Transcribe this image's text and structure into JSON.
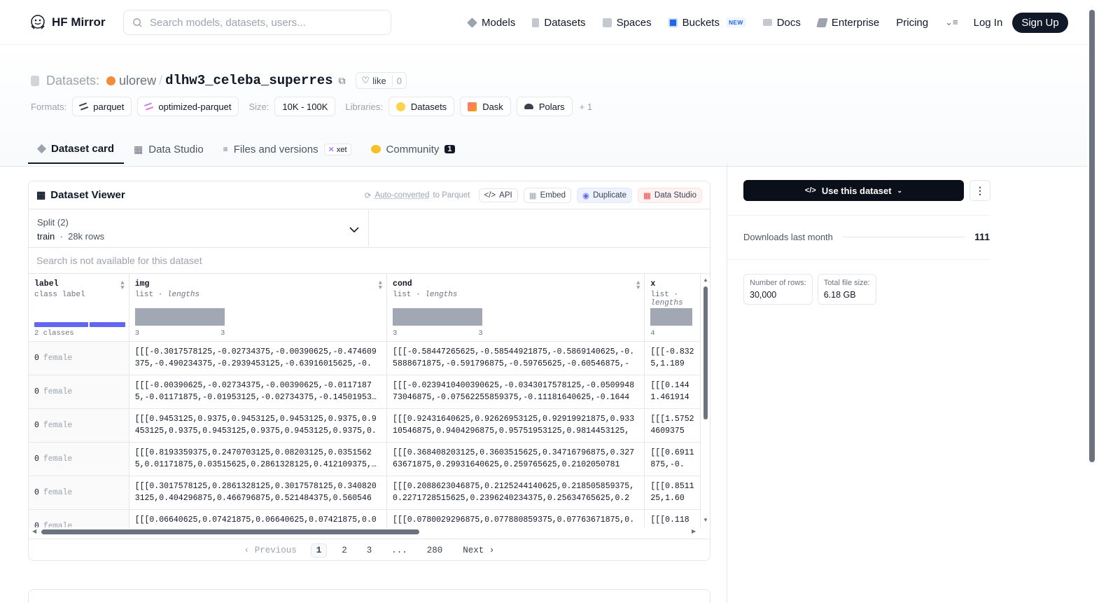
{
  "nav": {
    "brand": "HF Mirror",
    "search_placeholder": "Search models, datasets, users...",
    "links": [
      {
        "label": "Models",
        "icon": "cube-icon",
        "color": "#9ca3af"
      },
      {
        "label": "Datasets",
        "icon": "database-icon",
        "color": "#9ca3af"
      },
      {
        "label": "Spaces",
        "icon": "grid-icon",
        "color": "#9ca3af"
      },
      {
        "label": "Buckets",
        "icon": "bucket-icon",
        "color": "#2563eb",
        "badge": "NEW"
      },
      {
        "label": "Docs",
        "icon": "book-icon",
        "color": "#9ca3af"
      },
      {
        "label": "Enterprise",
        "icon": "building-icon",
        "color": "#9ca3af"
      },
      {
        "label": "Pricing"
      }
    ],
    "login": "Log In",
    "signup": "Sign Up"
  },
  "repo": {
    "prefix": "Datasets:",
    "owner": "ulorew",
    "name": "dlhw3_celeba_superres",
    "like_label": "like",
    "like_count": "0"
  },
  "tags": {
    "formats_label": "Formats:",
    "formats": [
      "parquet",
      "optimized-parquet"
    ],
    "size_label": "Size:",
    "size": "10K - 100K",
    "libraries_label": "Libraries:",
    "libraries": [
      "Datasets",
      "Dask",
      "Polars"
    ],
    "more": "+ 1"
  },
  "tabs": [
    {
      "label": "Dataset card",
      "active": true
    },
    {
      "label": "Data Studio"
    },
    {
      "label": "Files and versions",
      "badge": "xet"
    },
    {
      "label": "Community",
      "count": "1"
    }
  ],
  "viewer": {
    "title": "Dataset Viewer",
    "auto_converted": "Auto-converted",
    "auto_converted_suffix": "to Parquet",
    "actions": [
      "API",
      "Embed",
      "Duplicate",
      "Data Studio"
    ],
    "split_label": "Split (2)",
    "split_value": "train",
    "split_rows": "28k rows",
    "search_na": "Search is not available for this dataset",
    "columns": [
      {
        "name": "label",
        "type": "class label",
        "type_extra": "",
        "summary": "2 classes",
        "class_fractions": [
          0.6,
          0.4
        ]
      },
      {
        "name": "img",
        "type": "list",
        "type_extra": "lengths",
        "min": "3",
        "max": "3"
      },
      {
        "name": "cond",
        "type": "list",
        "type_extra": "lengths",
        "min": "3",
        "max": "3"
      },
      {
        "name": "x",
        "type": "list",
        "type_extra": "lengths",
        "min": "4",
        "max": ""
      }
    ],
    "rows": [
      {
        "label_num": "0",
        "label_txt": "female",
        "img": "[[[-0.3017578125,-0.02734375,-0.00390625,-0.474609375,-0.490234375,-0.2939453125,-0.63916015625,-0.",
        "cond": "[[[-0.58447265625,-0.58544921875,-0.5869140625,-0.5888671875,-0.591796875,-0.59765625,-0.60546875,-",
        "x": "[[[-0.8325,1.189"
      },
      {
        "label_num": "0",
        "label_txt": "female",
        "img": "[[[-0.00390625,-0.02734375,-0.00390625,-0.01171875,-0.01171875,-0.01953125,-0.02734375,-0.1450195312",
        "cond": "[[[-0.0239410400390625,-0.0343017578125,-0.050994873046875,-0.07562255859375,-0.11181640625,-0.1644",
        "x": "[[[0.1441.461914"
      },
      {
        "label_num": "0",
        "label_txt": "female",
        "img": "[[[0.9453125,0.9375,0.9453125,0.9453125,0.9375,0.9453125,0.9375,0.9453125,0.9375,0.9453125,0.9375,0.",
        "cond": "[[[0.92431640625,0.92626953125,0.92919921875,0.93310546875,0.9404296875,0.95751953125,0.9814453125,",
        "x": "[[[1.57524609375"
      },
      {
        "label_num": "0",
        "label_txt": "female",
        "img": "[[[0.8193359375,0.2470703125,0.08203125,0.03515625,0.01171875,0.03515625,0.2861328125,0.412109375,0.",
        "cond": "[[[0.368408203125,0.3603515625,0.34716796875,0.32763671875,0.29931640625,0.259765625,0.2102050781",
        "x": "[[[0.6911875,-0."
      },
      {
        "label_num": "0",
        "label_txt": "female",
        "img": "[[[0.3017578125,0.2861328125,0.3017578125,0.3408203125,0.404296875,0.466796875,0.521484375,0.560546",
        "cond": "[[[0.2088623046875,0.2125244140625,0.218505859375,0.2271728515625,0.2396240234375,0.25634765625,0.2",
        "x": "[[[0.851125,1.60"
      },
      {
        "label_num": "0",
        "label_txt": "female",
        "img": "[[[0.06640625,0.07421875,0.06640625,0.07421875,0.0",
        "cond": "[[[0.0780029296875,0.077880859375,0.07763671875,0.",
        "x": "[[[0.118"
      }
    ],
    "pagination": {
      "prev": "Previous",
      "pages": [
        "1",
        "2",
        "3",
        "...",
        "280"
      ],
      "current": "1",
      "next": "Next"
    }
  },
  "sidebar": {
    "use_button": "Use this dataset",
    "downloads_label": "Downloads last month",
    "downloads_value": "111",
    "stats": [
      {
        "key": "Number of rows:",
        "value": "30,000"
      },
      {
        "key": "Total file size:",
        "value": "6.18 GB"
      }
    ]
  }
}
